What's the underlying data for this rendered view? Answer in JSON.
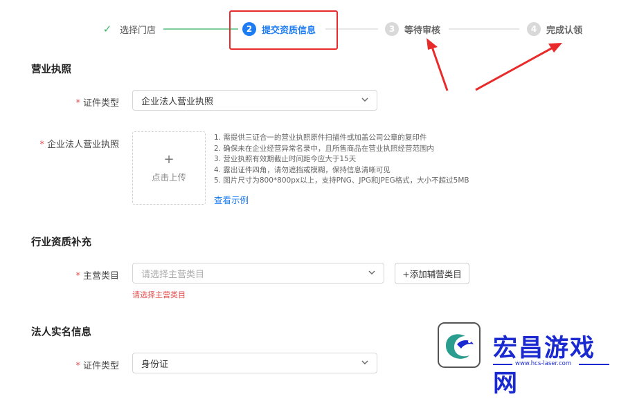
{
  "steps": [
    {
      "label": "选择门店",
      "state": "done",
      "icon": "check-icon"
    },
    {
      "number": "2",
      "label": "提交资质信息",
      "state": "active"
    },
    {
      "number": "3",
      "label": "等待审核",
      "state": "wait"
    },
    {
      "number": "4",
      "label": "完成认领",
      "state": "wait"
    }
  ],
  "colors": {
    "primary": "#1e7cf2",
    "done": "#3fb36b",
    "error": "#e34d4d",
    "annotation": "#e82a2a"
  },
  "license": {
    "section_title": "营业执照",
    "cert_type_label": "证件类型",
    "cert_type_value": "企业法人营业执照",
    "license_label": "企业法人营业执照",
    "upload_label": "点击上传",
    "tips": [
      "1. 需提供三证合一的营业执照原件扫描件或加盖公司公章的复印件",
      "2. 确保未在企业经营异常名录中，且所售商品在营业执照经营范围内",
      "3. 营业执照有效期截止时间距今应大于15天",
      "4. 露出证件四角，请勿遮挡或模糊，保持信息清晰可见",
      "5. 图片尺寸为800*800px以上，支持PNG、JPG和JPEG格式，大小不超过5MB"
    ],
    "example_link": "查看示例"
  },
  "industry": {
    "section_title": "行业资质补充",
    "main_category_label": "主营类目",
    "main_category_placeholder": "请选择主营类目",
    "add_button": "+添加辅营类目",
    "error_text": "请选择主营类目"
  },
  "legal_person": {
    "section_title": "法人实名信息",
    "cert_type_label": "证件类型",
    "cert_type_value": "身份证"
  },
  "watermark": {
    "title": "宏昌游戏网",
    "url": "www.hcs-laser.com"
  }
}
